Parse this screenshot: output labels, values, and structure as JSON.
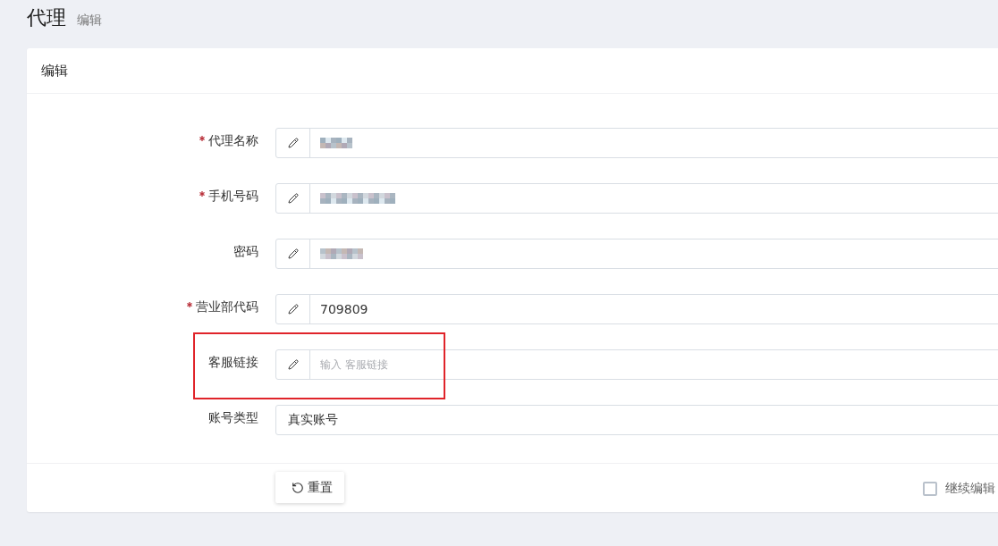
{
  "page": {
    "title": "代理",
    "subtitle": "编辑"
  },
  "card": {
    "title": "编辑"
  },
  "fields": [
    {
      "label": "代理名称",
      "required": true,
      "kind": "text",
      "redacted": true,
      "highlighted": false
    },
    {
      "label": "手机号码",
      "required": true,
      "kind": "text",
      "redacted": true,
      "highlighted": false
    },
    {
      "label": "密码",
      "required": false,
      "kind": "text",
      "redacted": true,
      "highlighted": false
    },
    {
      "label": "营业部代码",
      "required": true,
      "kind": "text",
      "value": "709809",
      "redacted": false,
      "highlighted": false
    },
    {
      "label": "客服链接",
      "required": false,
      "kind": "text",
      "placeholder": "输入 客服链接",
      "redacted": false,
      "highlighted": true
    },
    {
      "label": "账号类型",
      "required": false,
      "kind": "select",
      "value": "真实账号",
      "redacted": false,
      "highlighted": false
    }
  ],
  "footer": {
    "reset_button": "重置",
    "continue_editing": {
      "label": "继续编辑",
      "checked": false
    }
  }
}
